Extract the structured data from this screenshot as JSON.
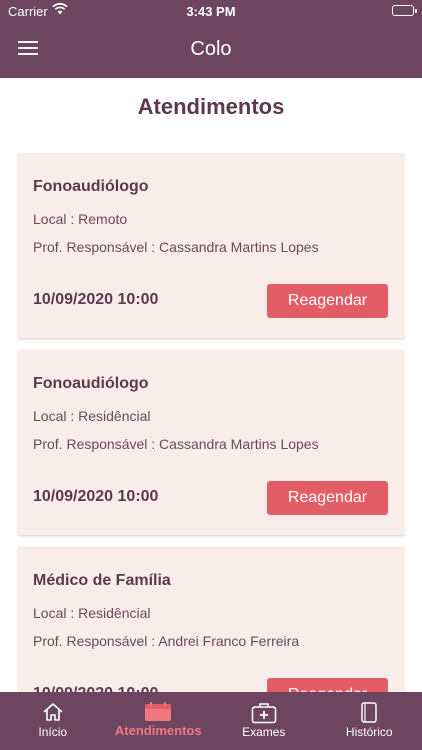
{
  "status_bar": {
    "carrier": "Carrier",
    "time": "3:43 PM"
  },
  "header": {
    "title": "Colo",
    "menu_icon": "hamburger-menu-icon"
  },
  "page": {
    "title": "Atendimentos"
  },
  "appointments": [
    {
      "specialty": "Fonoaudiólogo",
      "local": "Local : Remoto",
      "professional": "Prof. Responsável : Cassandra Martins Lopes",
      "datetime": "10/09/2020 10:00",
      "action_label": "Reagendar"
    },
    {
      "specialty": "Fonoaudiólogo",
      "local": "Local : Residêncial",
      "professional": "Prof. Responsável : Cassandra Martins Lopes",
      "datetime": "10/09/2020 10:00",
      "action_label": "Reagendar"
    },
    {
      "specialty": "Médico de Família",
      "local": "Local : Residêncial",
      "professional": "Prof. Responsável : Andrei Franco Ferreira",
      "datetime": "10/09/2020 10:00",
      "action_label": "Reagendar"
    }
  ],
  "tabbar": {
    "tabs": [
      {
        "label": "Início",
        "icon": "home-icon",
        "active": false
      },
      {
        "label": "Atendimentos",
        "icon": "calendar-icon",
        "active": true
      },
      {
        "label": "Exames",
        "icon": "medical-kit-icon",
        "active": false
      },
      {
        "label": "Histórico",
        "icon": "document-icon",
        "active": false
      }
    ]
  },
  "colors": {
    "primary": "#6d4560",
    "card_background": "#f8ede8",
    "accent": "#e35d67",
    "active_tab": "#f07880"
  }
}
